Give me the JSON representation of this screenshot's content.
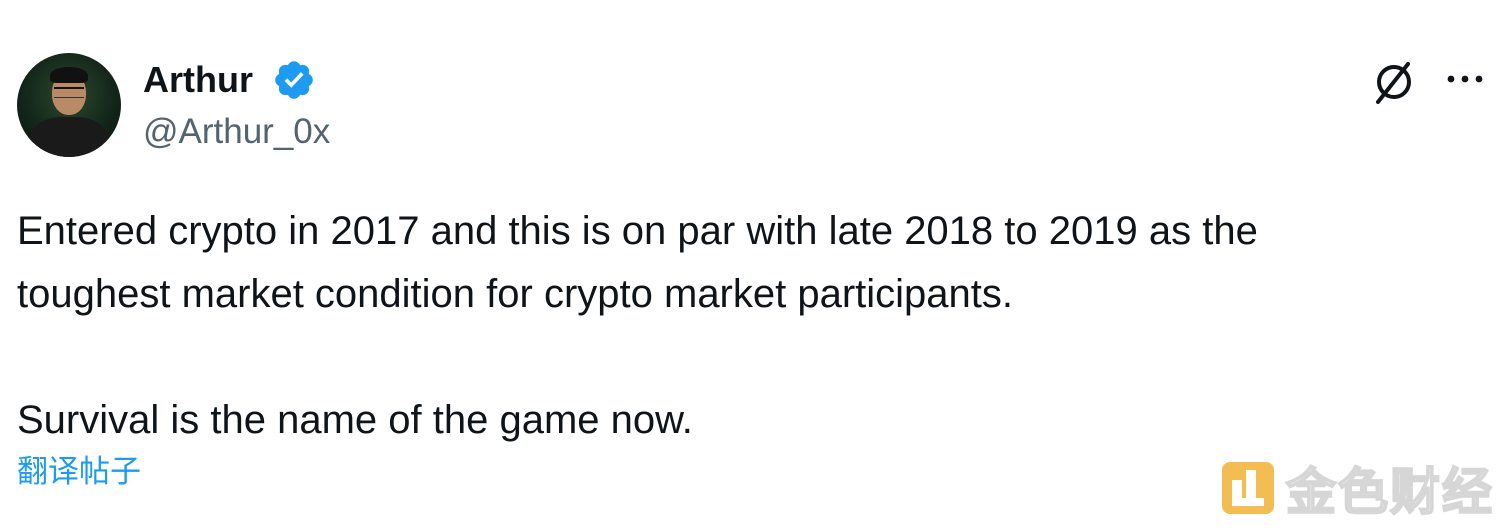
{
  "author": {
    "name": "Arthur",
    "handle": "@Arthur_0x",
    "verified": true,
    "avatar_icon": "profile-photo"
  },
  "header_actions": {
    "grok_icon": "grok-icon",
    "more_icon": "more-horizontal-icon"
  },
  "tweet": {
    "text": "Entered crypto in 2017 and this is on par with late 2018 to 2019 as the\ntoughest market condition for crypto market participants.\n\nSurvival is the name of the game now.",
    "translate_link": "翻译帖子"
  },
  "watermark": {
    "text": "金色财经"
  },
  "colors": {
    "text": "#0f1419",
    "secondary": "#536471",
    "accent": "#1d9bf0",
    "verified_badge": "#1d9bf0"
  }
}
